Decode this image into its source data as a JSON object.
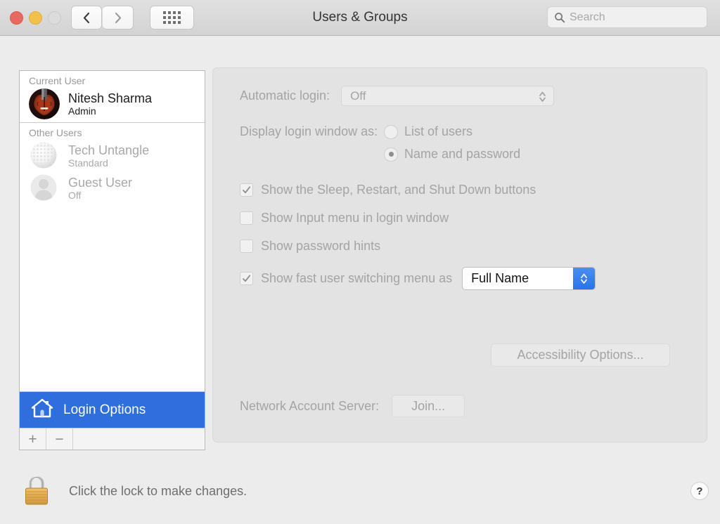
{
  "window": {
    "title": "Users & Groups",
    "accent_color": "#2f6fdd",
    "traffic_lights": {
      "close": "close-window-button",
      "minimize": "minimize-window-button",
      "zoom": "zoom-window-button"
    }
  },
  "toolbar": {
    "back_label": "‹",
    "forward_label": "›",
    "grid_label": "show-all-preferences"
  },
  "search": {
    "placeholder": "Search",
    "value": ""
  },
  "sidebar": {
    "current_user_header": "Current User",
    "other_users_header": "Other Users",
    "current_user": {
      "name": "Nitesh Sharma",
      "role": "Admin",
      "avatar": "violin-photo-avatar"
    },
    "other_users": [
      {
        "name": "Tech Untangle",
        "role": "Standard",
        "avatar": "golf-ball-photo-avatar"
      },
      {
        "name": "Guest User",
        "role": "Off",
        "avatar": "person-silhouette-avatar"
      }
    ],
    "login_options_label": "Login Options",
    "login_options_icon": "house-icon",
    "add_button_label": "+",
    "remove_button_label": "−"
  },
  "main": {
    "automatic_login": {
      "label": "Automatic login:",
      "value": "Off",
      "options": [
        "Off"
      ],
      "enabled": false
    },
    "display_login_window": {
      "label": "Display login window as:",
      "options": [
        {
          "label": "List of users",
          "selected": false
        },
        {
          "label": "Name and password",
          "selected": true
        }
      ],
      "enabled": false
    },
    "checkboxes": [
      {
        "label": "Show the Sleep, Restart, and Shut Down buttons",
        "checked": true
      },
      {
        "label": "Show Input menu in login window",
        "checked": false
      },
      {
        "label": "Show password hints",
        "checked": false
      },
      {
        "label": "Show fast user switching menu as",
        "checked": true
      }
    ],
    "fast_user_switching": {
      "value": "Full Name",
      "options": [
        "Full Name"
      ],
      "enabled": true
    },
    "accessibility_button": "Accessibility Options...",
    "network_account_server": {
      "label": "Network Account Server:",
      "join_button": "Join..."
    }
  },
  "footer": {
    "lock_icon": "closed-padlock-icon",
    "lock_message": "Click the lock to make changes.",
    "help_label": "?"
  }
}
